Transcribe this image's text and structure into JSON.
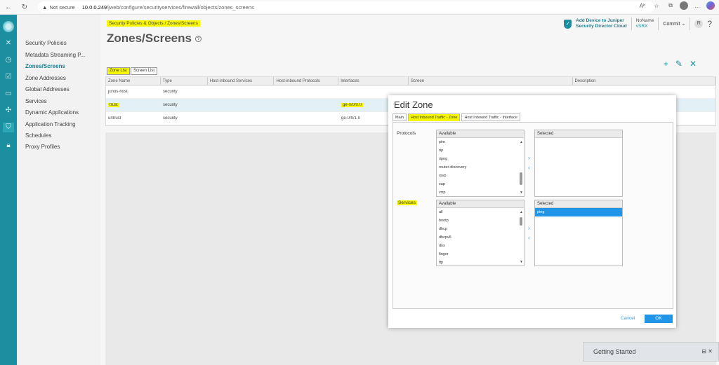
{
  "browser": {
    "back": "←",
    "reload": "↻",
    "warning": "▲",
    "not_secure": "Not secure",
    "host": "10.0.0.249",
    "path": "/jweb/configure/securityservices/firewall/objects/zones_screens",
    "right_icons": [
      "Aʰ",
      "☆",
      "⧉",
      "…"
    ]
  },
  "nav": {
    "items": [
      {
        "label": "Security Policies"
      },
      {
        "label": "Metadata Streaming P..."
      },
      {
        "label": "Zones/Screens"
      },
      {
        "label": "Zone Addresses"
      },
      {
        "label": "Global Addresses"
      },
      {
        "label": "Services"
      },
      {
        "label": "Dynamic Applications"
      },
      {
        "label": "Application Tracking"
      },
      {
        "label": "Schedules"
      },
      {
        "label": "Proxy Profiles"
      }
    ]
  },
  "header": {
    "breadcrumb": "Security Policies & Objects  /  Zones/Screens",
    "title": "Zones/Screens",
    "help": "?",
    "add_device_line1": "Add Device to Juniper",
    "add_device_line2": "Security Director Cloud",
    "device_name": "NoName",
    "device_type": "vSRX",
    "commit": "Commit ⌄",
    "user_initial": "R",
    "help_q": "?"
  },
  "actions": {
    "add": "+",
    "edit": "✎",
    "delete": "✕"
  },
  "tabs": {
    "zone_list": "Zone List",
    "screen_list": "Screen List"
  },
  "table": {
    "headers": [
      "Zone Name",
      "Type",
      "Host-inbound Services",
      "Host-inbound Protocols",
      "Interfaces",
      "Screen",
      "Description"
    ],
    "rows": [
      {
        "name": "junos-host",
        "type": "security",
        "interfaces": ""
      },
      {
        "name": "trust",
        "type": "security",
        "interfaces": "ge-0/0/0.0"
      },
      {
        "name": "untrust",
        "type": "security",
        "interfaces": "ge-0/0/1.0"
      }
    ]
  },
  "dialog": {
    "title": "Edit Zone",
    "tabs": [
      "Main",
      "Host Inbound Traffic - Zone",
      "Host Inbound Traffic - Interface"
    ],
    "protocols_label": "Protocols",
    "services_label": "Services",
    "available": "Available",
    "selected": "Selected",
    "move_right": "›",
    "move_left": "‹",
    "protocols_available": [
      "pim",
      "rip",
      "ripng",
      "router-discovery",
      "rsvp",
      "sap",
      "vrrp"
    ],
    "services_available": [
      "all",
      "bootp",
      "dhcp",
      "dhcpv6",
      "dns",
      "finger",
      "ftp"
    ],
    "services_selected": [
      "ping"
    ],
    "cancel": "Cancel",
    "ok": "OK"
  },
  "getting_started": {
    "label": "Getting Started",
    "icons": "⊟  ✕"
  },
  "colors": {
    "accent": "#1b8fa0",
    "highlight": "#f7f700",
    "primary_button": "#2196e8"
  }
}
